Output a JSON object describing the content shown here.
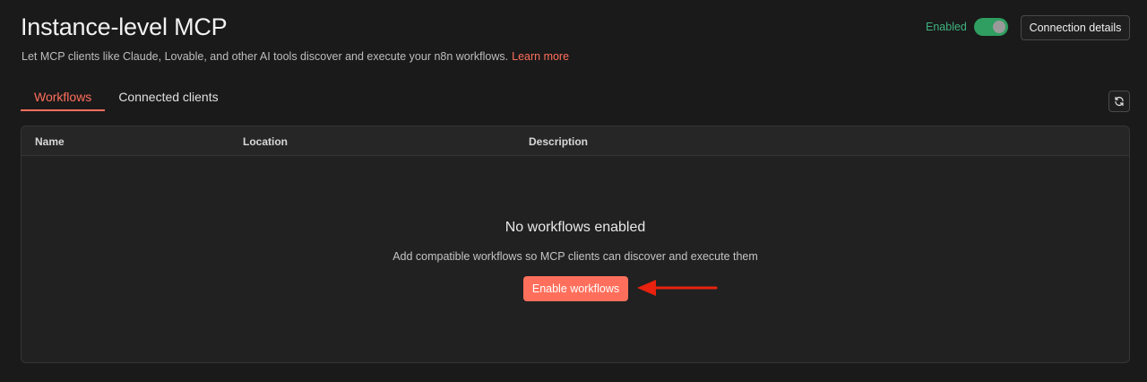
{
  "header": {
    "title": "Instance-level MCP",
    "subtitle": "Let MCP clients like Claude, Lovable, and other AI tools discover and execute your n8n workflows.",
    "learn_more": "Learn more",
    "status_label": "Enabled",
    "toggle_state": "on",
    "connection_button": "Connection details"
  },
  "tabs": [
    {
      "label": "Workflows",
      "active": true
    },
    {
      "label": "Connected clients",
      "active": false
    }
  ],
  "table": {
    "columns": [
      "Name",
      "Location",
      "Description"
    ],
    "empty_title": "No workflows enabled",
    "empty_description": "Add compatible workflows so MCP clients can discover and execute them",
    "action_button": "Enable workflows"
  },
  "icons": {
    "refresh": "refresh-icon",
    "annotation": "red-arrow-icon"
  },
  "colors": {
    "accent": "#ff6f5c",
    "enabled_text": "#3fb27f",
    "toggle_on": "#2f9e60",
    "annotation_arrow": "#e8220f"
  }
}
